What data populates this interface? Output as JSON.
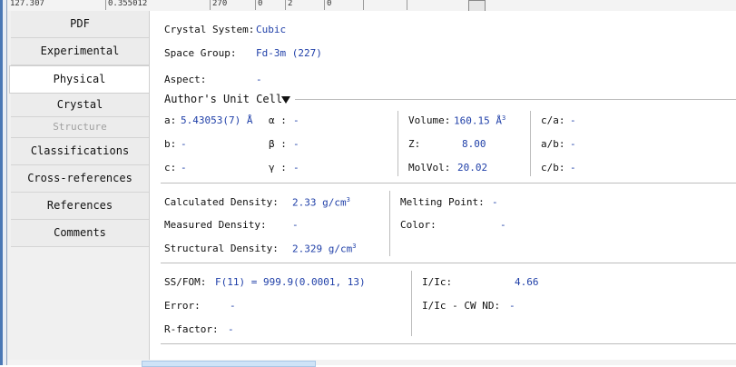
{
  "top_table": {
    "cells": [
      "127.307",
      "0.355012",
      "270",
      "0",
      "2",
      "0",
      ""
    ]
  },
  "sidebar": {
    "items": [
      {
        "label": "PDF",
        "state": "normal"
      },
      {
        "label": "Experimental",
        "state": "normal"
      },
      {
        "label": "Physical",
        "state": "active"
      },
      {
        "label": "Crystal",
        "state": "normal"
      },
      {
        "label": "Structure",
        "state": "disabled"
      },
      {
        "label": "Classifications",
        "state": "normal"
      },
      {
        "label": "Cross-references",
        "state": "normal"
      },
      {
        "label": "References",
        "state": "normal"
      },
      {
        "label": "Comments",
        "state": "normal"
      }
    ]
  },
  "crystal": {
    "system_label": "Crystal System:",
    "system_value": "Cubic",
    "space_group_label": "Space Group:",
    "space_group_value": "Fd-3m (227)",
    "aspect_label": "Aspect:",
    "aspect_value": "-"
  },
  "unit_cell": {
    "header": "Author's Unit Cell",
    "a_label": "a:",
    "a_value": "5.43053(7) Å",
    "alpha_label": "α :",
    "alpha_value": "-",
    "b_label": "b:",
    "b_value": "-",
    "beta_label": "β :",
    "beta_value": "-",
    "c_label": "c:",
    "c_value": "-",
    "gamma_label": "γ :",
    "gamma_value": "-",
    "volume_label": "Volume:",
    "volume_value": "160.15 Å",
    "z_label": "Z:",
    "z_value": "8.00",
    "molvol_label": "MolVol:",
    "molvol_value": "20.02",
    "ca_label": "c/a:",
    "ca_value": "-",
    "ab_label": "a/b:",
    "ab_value": "-",
    "cb_label": "c/b:",
    "cb_value": "-"
  },
  "density": {
    "calc_label": "Calculated Density:",
    "calc_value": "2.33 g/cm",
    "meas_label": "Measured Density:",
    "meas_value": "-",
    "struct_label": "Structural Density:",
    "struct_value": "2.329 g/cm",
    "melting_label": "Melting Point:",
    "melting_value": "-",
    "color_label": "Color:",
    "color_value": "-"
  },
  "fom": {
    "ssfom_label": "SS/FOM:",
    "ssfom_value": "F(11) = 999.9(0.0001, 13)",
    "error_label": "Error:",
    "error_value": "-",
    "rfactor_label": "R-factor:",
    "rfactor_value": "-",
    "iic_label": "I/Ic:",
    "iic_value": "4.66",
    "iic_cwnd_label": "I/Ic - CW ND:",
    "iic_cwnd_value": "-"
  },
  "colors": {
    "value_blue": "#1f3fa8",
    "frame_blue": "#4a78b5"
  }
}
